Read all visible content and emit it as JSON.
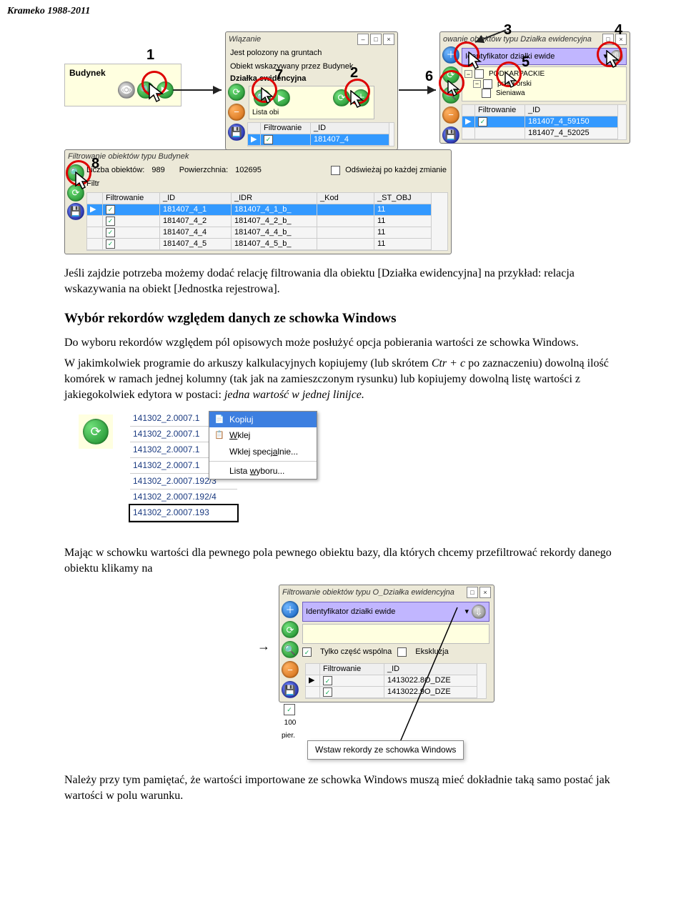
{
  "header": "Krameko 1988-2011",
  "paras": {
    "p1a": "Jeśli zajdzie potrzeba możemy dodać relację filtrowania dla obiektu [Działka ewidencyjna] na przykład: relacja wskazywania na obiekt [Jednostka rejestrowa].",
    "h1": "Wybór rekordów względem danych ze schowka Windows",
    "p2": "Do wyboru rekordów względem pól opisowych może posłużyć opcja pobierania wartości ze schowka Windows.",
    "p3a": "W jakimkolwiek programie do arkuszy kalkulacyjnych kopiujemy (lub skrótem ",
    "p3i": "Ctr + c",
    "p3b": " po zaznaczeniu) dowolną ilość komórek w ramach jednej kolumny (tak jak na zamieszczonym rysunku) lub kopiujemy dowolną listę wartości z jakiegokolwiek edytora w postaci: ",
    "p3c": "jedna wartość w jednej linijce.",
    "p4": "Mając w schowku wartości dla pewnego pola pewnego obiektu bazy, dla których chcemy przefiltrować rekordy danego obiektu klikamy na",
    "p5": "Należy przy tym pamiętać, że wartości importowane ze schowka Windows muszą mieć dokładnie taką samo postać jak wartości w polu warunku."
  },
  "fig1": {
    "budynek": "Budynek",
    "wiazanie_title": "Wiązanie",
    "jest_polozony": "Jest polozony na gruntach",
    "obiekt_wskazywany": "Obiekt wskazywany przez Budynek",
    "dzialka_ew": "Działka ewidencyjna",
    "lista_ob": "Lista obi",
    "filtrowanie": "Filtrowanie",
    "id_hdr": "_ID",
    "id_val": "181407_4",
    "rpanel_title": "owanie obiektów typu Działka ewidencyjna",
    "ident_label": "Identyfikator działki ewide",
    "podkarpackie": "PODKARPACKIE",
    "przeworski": "przeworski",
    "sieniawa": "Sieniawa",
    "r_filtr": "Filtrowanie",
    "r_id": "_ID",
    "r_val1": "181407_4_59150",
    "r_val2": "181407_4_52025",
    "bw_title": "Filtrowanie obiektów typu Budynek",
    "liczba_lab": "Liczba obiektów:",
    "liczba_val": "989",
    "pow_lab": "Powierzchnia:",
    "pow_val": "102695",
    "odsw": "Odświeżaj po każdej zmianie",
    "filtr": "Filtr",
    "cols": {
      "c1": "Filtrowanie",
      "c2": "_ID",
      "c3": "_IDR",
      "c4": "_Kod",
      "c5": "_ST_OBJ"
    },
    "rows": [
      {
        "id": "181407_4_1",
        "idr": "181407_4_1_b_",
        "k": "",
        "s": "11",
        "sel": true
      },
      {
        "id": "181407_4_2",
        "idr": "181407_4_2_b_",
        "k": "",
        "s": "11",
        "sel": false
      },
      {
        "id": "181407_4_4",
        "idr": "181407_4_4_b_",
        "k": "",
        "s": "11",
        "sel": false
      },
      {
        "id": "181407_4_5",
        "idr": "181407_4_5_b_",
        "k": "",
        "s": "11",
        "sel": false
      }
    ],
    "marks": [
      "1",
      "2",
      "3",
      "4",
      "5",
      "6",
      "7",
      "8"
    ]
  },
  "fig2": {
    "values": [
      "141302_2.0007.1",
      "141302_2.0007.1",
      "141302_2.0007.1",
      "141302_2.0007.1",
      "141302_2.0007.192/3",
      "141302_2.0007.192/4",
      "141302_2.0007.193"
    ],
    "menu": {
      "kopiuj": "Kopiuj",
      "wklej": "Wklej",
      "wklej_spec": "Wklej specjalnie...",
      "lista": "Lista wyboru..."
    }
  },
  "fig3": {
    "title": "Filtrowanie obiektów typu O_Działka ewidencyjna",
    "ident": "Identyfikator działki ewide",
    "tylko": "Tylko część wspólna",
    "eksk": "Ekskluzja",
    "filtr": "Filtrowanie",
    "id": "_ID",
    "r1": "1413022.8O_DZE",
    "r2": "1413022.9O_DZE",
    "sto": "100",
    "pier": "pier.",
    "tooltip": "Wstaw rekordy ze schowka Windows"
  }
}
